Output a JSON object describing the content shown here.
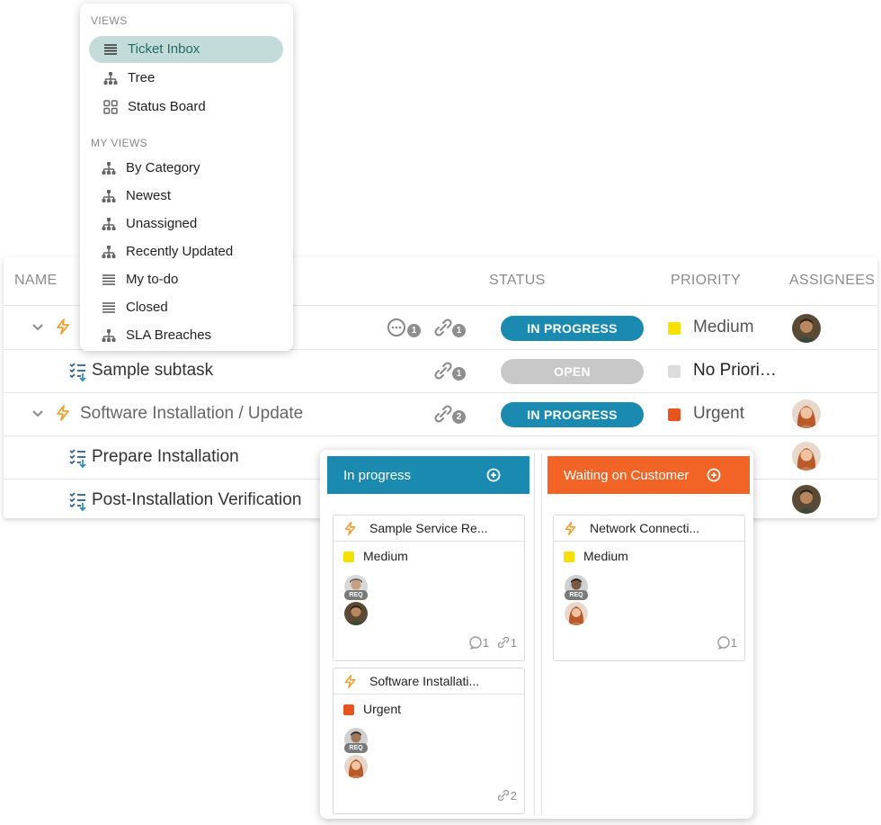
{
  "table": {
    "headers": {
      "name": "NAME",
      "status": "STATUS",
      "priority": "PRIORITY",
      "assignees": "ASSIGNEES"
    },
    "rows": [
      {
        "name": "",
        "comments": "1",
        "links": "1",
        "status": "IN PROGRESS",
        "priority": "Medium"
      },
      {
        "name": "Sample subtask",
        "links": "1",
        "status": "OPEN",
        "priority": "No Priori…"
      },
      {
        "name": "Software Installation / Update",
        "links": "2",
        "status": "IN PROGRESS",
        "priority": "Urgent"
      },
      {
        "name": "Prepare Installation"
      },
      {
        "name": "Post-Installation Verification"
      }
    ]
  },
  "views_menu": {
    "views_heading": "VIEWS",
    "views": [
      {
        "label": "Ticket Inbox",
        "icon": "list-icon",
        "active": true
      },
      {
        "label": "Tree",
        "icon": "tree-icon"
      },
      {
        "label": "Status Board",
        "icon": "board-icon"
      }
    ],
    "my_views_heading": "MY VIEWS",
    "my_views": [
      {
        "label": "By Category",
        "icon": "tree-icon"
      },
      {
        "label": "Newest",
        "icon": "tree-icon"
      },
      {
        "label": "Unassigned",
        "icon": "tree-icon"
      },
      {
        "label": "Recently Updated",
        "icon": "tree-icon"
      },
      {
        "label": "My to-do",
        "icon": "list-icon"
      },
      {
        "label": "Closed",
        "icon": "list-icon"
      },
      {
        "label": "SLA Breaches",
        "icon": "tree-icon"
      }
    ]
  },
  "board": {
    "columns": [
      {
        "title": "In progress",
        "color": "#1a8ab0",
        "cards": [
          {
            "title": "Sample Service Re...",
            "priority": "Medium",
            "priority_color": "#f5e000",
            "req": "REQ",
            "comments": "1",
            "links": "1"
          },
          {
            "title": "Software Installati...",
            "priority": "Urgent",
            "priority_color": "#e8541e",
            "req": "REQ",
            "links": "2"
          }
        ]
      },
      {
        "title": "Waiting on Customer",
        "color": "#f26425",
        "cards": [
          {
            "title": "Network Connecti...",
            "priority": "Medium",
            "priority_color": "#f5e000",
            "req": "REQ",
            "comments": "1"
          }
        ]
      }
    ]
  },
  "colors": {
    "in_progress": "#1a8ab0",
    "open": "#c8c8c8",
    "medium": "#f5e000",
    "no_priority": "#dcdcdc",
    "urgent": "#e8541e",
    "ticket_icon": "#f0a030",
    "subtask_icon": "#2a8fc4",
    "active_view_bg": "#c3dcd9"
  }
}
